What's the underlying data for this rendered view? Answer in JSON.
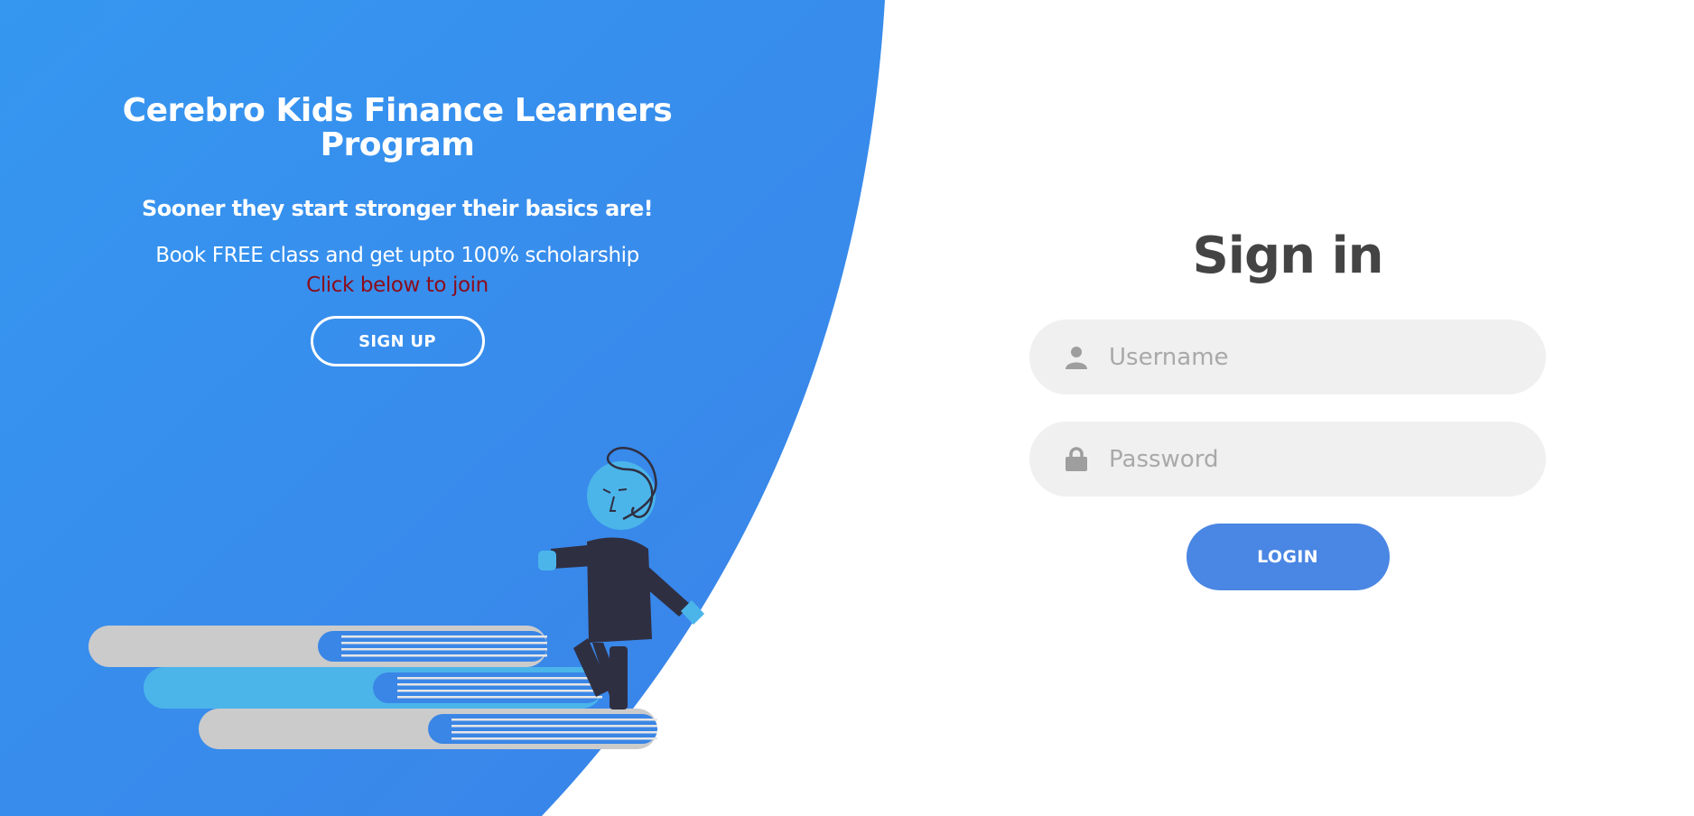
{
  "program": {
    "title": "Cerebro Kids Finance Learners Program",
    "tagline": "Sooner they start stronger their basics are!",
    "promo": "Book FREE class and get upto 100% scholarship",
    "cta_note": "Click below to join",
    "signup_label": "SIGN UP"
  },
  "signin": {
    "title": "Sign in",
    "username_placeholder": "Username",
    "password_placeholder": "Password",
    "login_label": "LOGIN"
  },
  "icons": {
    "username": "user-icon",
    "password": "lock-icon"
  },
  "colors": {
    "panel_blue": "#3592ef",
    "login_button": "#4a86e3",
    "cta_note": "#8b0c1c",
    "input_bg": "#f0f0f0"
  }
}
